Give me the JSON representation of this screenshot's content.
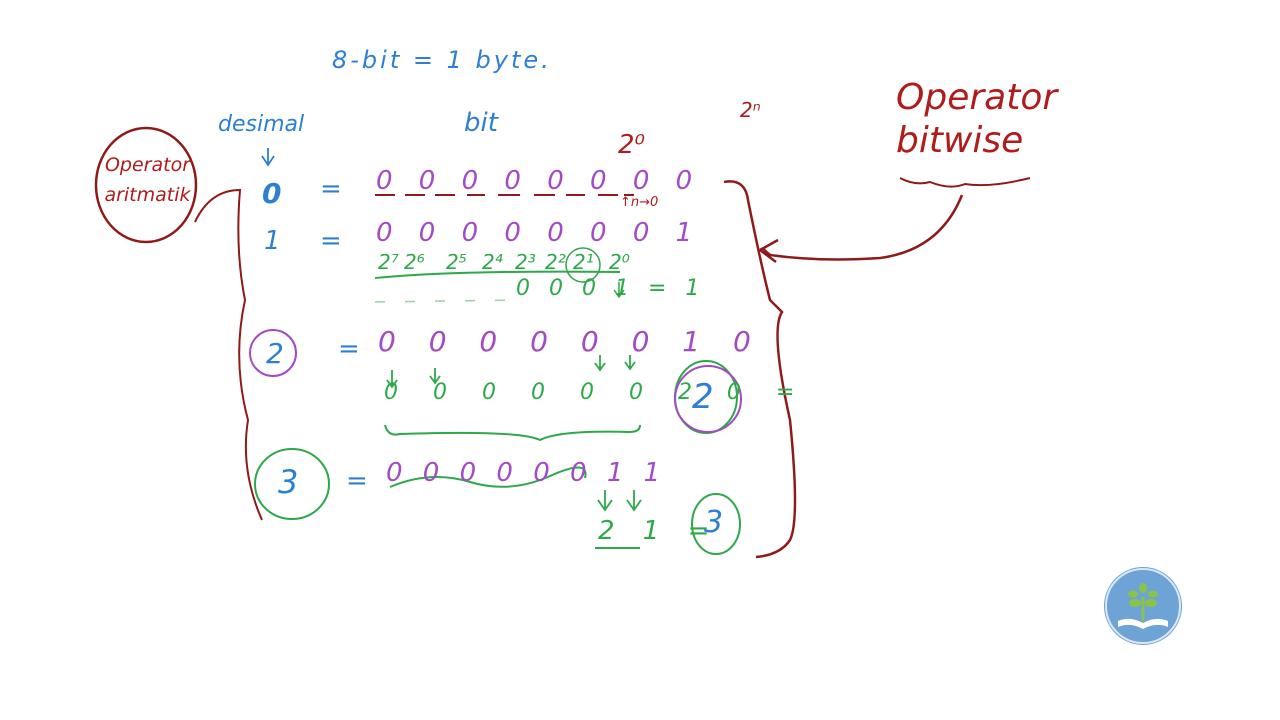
{
  "header": {
    "eq": "8-bit = 1 byte."
  },
  "labels": {
    "decimal": "desimal",
    "bit": "bit",
    "op_arith": "Operator aritmatik",
    "op_bitwise": "Operator bitwise",
    "pow_top": "2⁰",
    "pow_n": "2ⁿ",
    "n_to_0": "↑n→0"
  },
  "rows": [
    {
      "dec": "0",
      "eq": "=",
      "bits": "0 0 0 0 0 0 0 0"
    },
    {
      "dec": "1",
      "eq": "=",
      "bits": "0 0 0 0 0 0 0 1"
    },
    {
      "dec": "2",
      "eq": "=",
      "bits": "0 0 0 0 0 0 1 0"
    },
    {
      "dec": "3",
      "eq": "=",
      "bits": "0 0 0 0 0 0 1 1"
    }
  ],
  "powers": [
    "2⁷",
    "2⁶",
    "2⁵",
    "2⁴",
    "2³",
    "2²",
    "2¹",
    "2⁰"
  ],
  "work": {
    "row1_result": "0 0 0   1 = 1",
    "row2_values": "0 0 0 0 0 0 2 0 =",
    "row2_answer": "2",
    "row3_values": "2 1 =",
    "row3_answer": "3"
  },
  "logo": {
    "icon": "book-plant-logo",
    "color": "#6ea3d6"
  }
}
